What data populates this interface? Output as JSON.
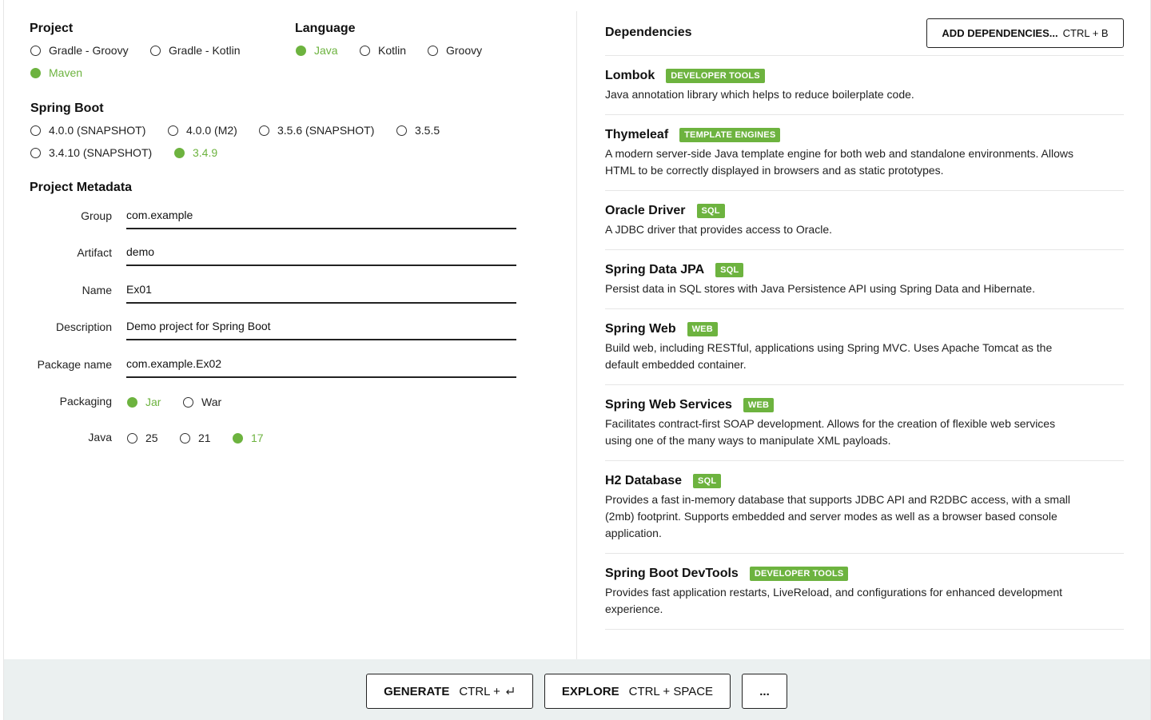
{
  "project": {
    "title": "Project",
    "options": [
      {
        "label": "Gradle - Groovy",
        "selected": false
      },
      {
        "label": "Gradle - Kotlin",
        "selected": false
      },
      {
        "label": "Maven",
        "selected": true
      }
    ]
  },
  "language": {
    "title": "Language",
    "options": [
      {
        "label": "Java",
        "selected": true
      },
      {
        "label": "Kotlin",
        "selected": false
      },
      {
        "label": "Groovy",
        "selected": false
      }
    ]
  },
  "spring_boot": {
    "title": "Spring Boot",
    "options": [
      {
        "label": "4.0.0 (SNAPSHOT)",
        "selected": false
      },
      {
        "label": "4.0.0 (M2)",
        "selected": false
      },
      {
        "label": "3.5.6 (SNAPSHOT)",
        "selected": false
      },
      {
        "label": "3.5.5",
        "selected": false
      },
      {
        "label": "3.4.10 (SNAPSHOT)",
        "selected": false
      },
      {
        "label": "3.4.9",
        "selected": true
      }
    ]
  },
  "metadata": {
    "title": "Project Metadata",
    "group": {
      "label": "Group",
      "value": "com.example"
    },
    "artifact": {
      "label": "Artifact",
      "value": "demo"
    },
    "name": {
      "label": "Name",
      "value": "Ex01"
    },
    "description": {
      "label": "Description",
      "value": "Demo project for Spring Boot"
    },
    "package_name": {
      "label": "Package name",
      "value": "com.example.Ex02"
    },
    "packaging": {
      "label": "Packaging",
      "options": [
        {
          "label": "Jar",
          "selected": true
        },
        {
          "label": "War",
          "selected": false
        }
      ]
    },
    "java": {
      "label": "Java",
      "options": [
        {
          "label": "25",
          "selected": false
        },
        {
          "label": "21",
          "selected": false
        },
        {
          "label": "17",
          "selected": true
        }
      ]
    }
  },
  "dependencies": {
    "title": "Dependencies",
    "add_button": {
      "label": "ADD DEPENDENCIES...",
      "shortcut": "CTRL + B"
    },
    "items": [
      {
        "name": "Lombok",
        "badge": "DEVELOPER TOOLS",
        "description": "Java annotation library which helps to reduce boilerplate code."
      },
      {
        "name": "Thymeleaf",
        "badge": "TEMPLATE ENGINES",
        "description": "A modern server-side Java template engine for both web and standalone environments. Allows HTML to be correctly displayed in browsers and as static prototypes."
      },
      {
        "name": "Oracle Driver",
        "badge": "SQL",
        "description": "A JDBC driver that provides access to Oracle."
      },
      {
        "name": "Spring Data JPA",
        "badge": "SQL",
        "description": "Persist data in SQL stores with Java Persistence API using Spring Data and Hibernate."
      },
      {
        "name": "Spring Web",
        "badge": "WEB",
        "description": "Build web, including RESTful, applications using Spring MVC. Uses Apache Tomcat as the default embedded container."
      },
      {
        "name": "Spring Web Services",
        "badge": "WEB",
        "description": "Facilitates contract-first SOAP development. Allows for the creation of flexible web services using one of the many ways to manipulate XML payloads."
      },
      {
        "name": "H2 Database",
        "badge": "SQL",
        "description": "Provides a fast in-memory database that supports JDBC API and R2DBC access, with a small (2mb) footprint. Supports embedded and server modes as well as a browser based console application."
      },
      {
        "name": "Spring Boot DevTools",
        "badge": "DEVELOPER TOOLS",
        "description": "Provides fast application restarts, LiveReload, and configurations for enhanced development experience."
      }
    ]
  },
  "footer": {
    "generate": {
      "label": "GENERATE",
      "shortcut": "CTRL +",
      "icon": "enter-key-icon"
    },
    "explore": {
      "label": "EXPLORE",
      "shortcut": "CTRL + SPACE"
    },
    "more": {
      "label": "..."
    }
  },
  "colors": {
    "accent": "#6db33f",
    "footer_bg": "#ebf0f0",
    "border": "#222222"
  }
}
